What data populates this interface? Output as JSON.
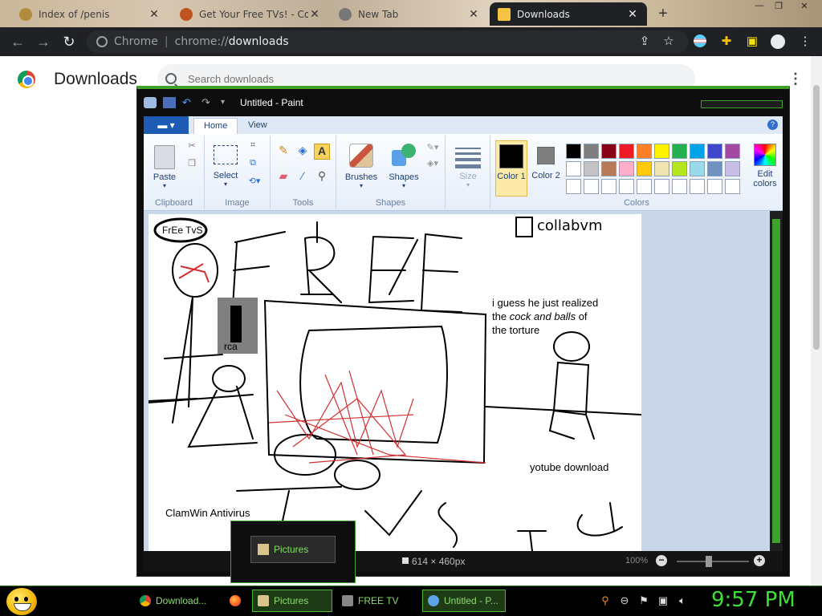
{
  "tabs": [
    {
      "title": "Index of /penis",
      "favicon_color": "#b38a3e"
    },
    {
      "title": "Get Your Free TVs! - Com",
      "favicon_color": "#c0541f"
    },
    {
      "title": "New Tab",
      "favicon_color": "#777777"
    },
    {
      "title": "Downloads",
      "favicon_color": "#f5c242"
    }
  ],
  "omnibox": {
    "site": "Chrome",
    "url_prefix": "chrome://",
    "url_path": "downloads"
  },
  "downloads_page": {
    "title": "Downloads",
    "search_placeholder": "Search downloads"
  },
  "paint": {
    "window_title": "Untitled - Paint",
    "file_menu": "▾",
    "tabs": [
      "Home",
      "View"
    ],
    "groups": {
      "clipboard": {
        "label": "Clipboard",
        "paste": "Paste"
      },
      "image": {
        "label": "Image",
        "select": "Select"
      },
      "tools": {
        "label": "Tools"
      },
      "shapes": {
        "label": "Shapes",
        "brushes": "Brushes",
        "shapes": "Shapes"
      },
      "size": {
        "label": "Size"
      },
      "colors": {
        "label": "Colors",
        "color1": "Color 1",
        "color2": "Color 2",
        "edit": "Edit colors"
      }
    },
    "color1": "#000000",
    "color2": "#7f7f7f",
    "palette_row1": [
      "#000000",
      "#7f7f7f",
      "#880015",
      "#ed1c24",
      "#ff7f27",
      "#fff200",
      "#22b14c",
      "#00a2e8",
      "#3f48cc",
      "#a349a4"
    ],
    "palette_row2": [
      "#ffffff",
      "#c3c3c3",
      "#b97a57",
      "#ffaec9",
      "#ffc90e",
      "#efe4b0",
      "#b5e61d",
      "#99d9ea",
      "#7092be",
      "#c8bfe7"
    ],
    "canvas_text": {
      "speech": "FrEe TvS",
      "logo": "collabvm",
      "quote_a": "i guess he just realized",
      "quote_b_1": "the ",
      "quote_b_em": "cock and balls",
      "quote_b_2": " of",
      "quote_c": "the torture",
      "rca": "rca",
      "yt": "yotube download",
      "clam": "ClamWin Antivirus"
    },
    "status": {
      "size": "614 × 460px",
      "zoom": "100%"
    }
  },
  "thumbnail_popup": {
    "label": "Pictures"
  },
  "taskbar": {
    "items": [
      {
        "label": "Download...",
        "icon_color": "#4285f4"
      },
      {
        "label": "Pictures",
        "icon_color": "#d9c48b"
      },
      {
        "label": "FREE TV",
        "icon_color": "#888888"
      },
      {
        "label": "Untitled - P...",
        "icon_color": "#5da5e8"
      }
    ],
    "clock": "9:57 PM"
  }
}
